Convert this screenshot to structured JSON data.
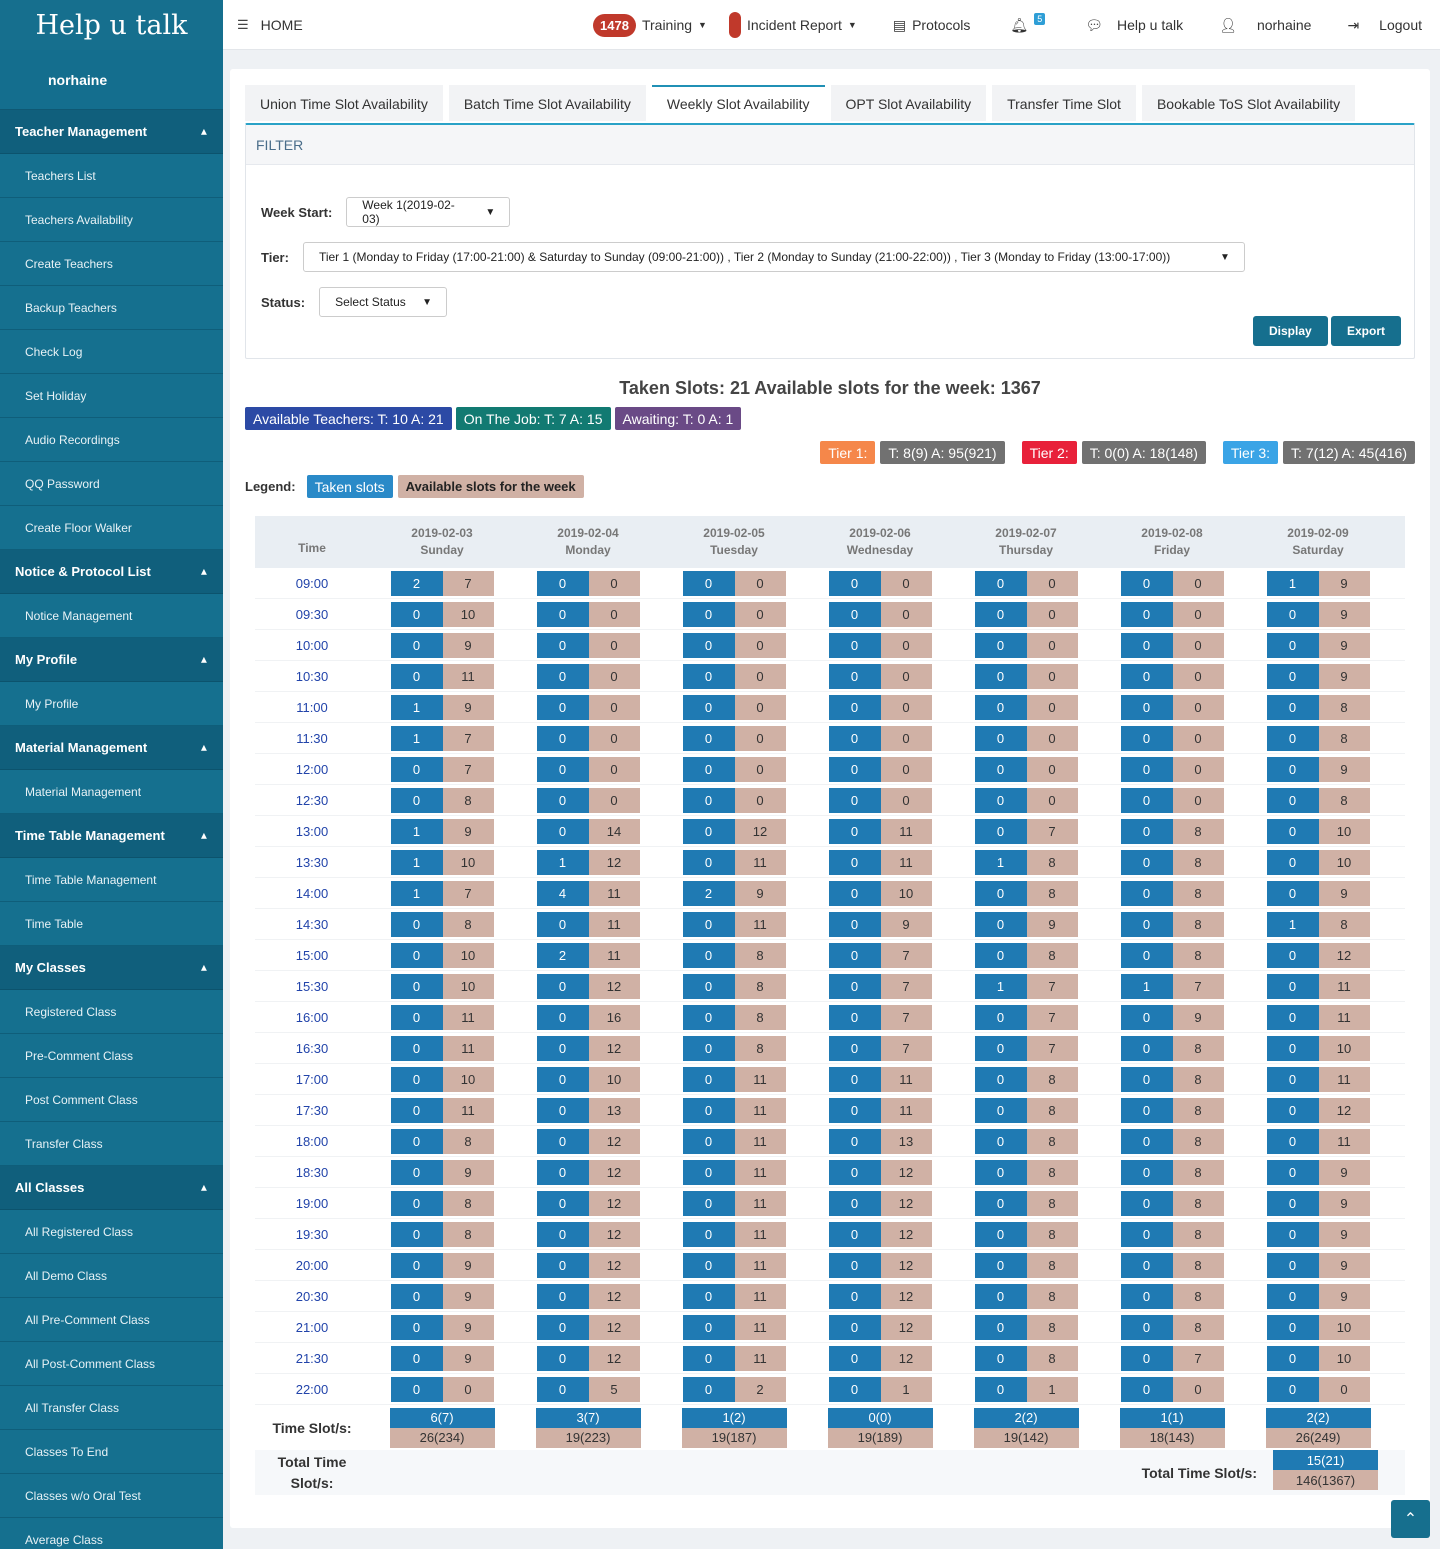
{
  "brand": "Help u talk",
  "sidebar": {
    "user": "norhaine",
    "sections": [
      {
        "title": "Teacher Management",
        "items": [
          "Teachers List",
          "Teachers Availability",
          "Create Teachers",
          "Backup Teachers",
          "Check Log",
          "Set Holiday",
          "Audio Recordings",
          "QQ Password",
          "Create Floor Walker"
        ]
      },
      {
        "title": "Notice & Protocol List",
        "items": [
          "Notice Management"
        ]
      },
      {
        "title": "My Profile",
        "items": [
          "My Profile"
        ]
      },
      {
        "title": "Material Management",
        "items": [
          "Material Management"
        ]
      },
      {
        "title": "Time Table Management",
        "items": [
          "Time Table Management",
          "Time Table"
        ]
      },
      {
        "title": "My Classes",
        "items": [
          "Registered Class",
          "Pre-Comment Class",
          "Post Comment Class",
          "Transfer Class"
        ]
      },
      {
        "title": "All Classes",
        "items": [
          "All Registered Class",
          "All Demo Class",
          "All Pre-Comment Class",
          "All Post-Comment Class",
          "All Transfer Class",
          "Classes To End",
          "Classes w/o Oral Test",
          "Average Class"
        ]
      }
    ]
  },
  "topbar": {
    "home": "HOME",
    "training_count": "1478",
    "training": "Training",
    "incident": "Incident Report",
    "protocols": "Protocols",
    "notif_count": "5",
    "help": "Help u talk",
    "user": "norhaine",
    "logout": "Logout"
  },
  "tabs": [
    "Union Time Slot Availability",
    "Batch Time Slot Availability",
    "Weekly Slot Availability",
    "OPT Slot Availability",
    "Transfer Time Slot",
    "Bookable ToS Slot Availability"
  ],
  "filter": {
    "title": "FILTER",
    "week_label": "Week Start:",
    "week_value": "Week 1(2019-02-03)",
    "tier_label": "Tier:",
    "tier_value": "Tier 1 (Monday to Friday (17:00-21:00) & Saturday to Sunday (09:00-21:00)) , Tier 2 (Monday to Sunday (21:00-22:00)) , Tier 3 (Monday to Friday (13:00-17:00))",
    "status_label": "Status:",
    "status_value": "Select Status",
    "display": "Display",
    "export": "Export"
  },
  "summary": "Taken Slots: 21  Available slots for the week: 1367",
  "pills": [
    {
      "text": "Available Teachers: T: 10 A: 21",
      "color": "#2c4aa5"
    },
    {
      "text": "On The Job: T: 7 A: 15",
      "color": "#127a72"
    },
    {
      "text": "Awaiting: T: 0 A: 1",
      "color": "#6a4a86"
    }
  ],
  "tiers": [
    {
      "label": "Tier 1:",
      "value": "T: 8(9) A: 95(921)",
      "color": "#f5874a"
    },
    {
      "label": "Tier 2:",
      "value": "T: 0(0) A: 18(148)",
      "color": "#e8213a"
    },
    {
      "label": "Tier 3:",
      "value": "T: 7(12) A: 45(416)",
      "color": "#3aa4e6"
    }
  ],
  "legend": {
    "label": "Legend:",
    "taken": "Taken slots",
    "available": "Available slots for the week"
  },
  "table": {
    "time_header": "Time",
    "days": [
      {
        "date": "2019-02-03",
        "day": "Sunday"
      },
      {
        "date": "2019-02-04",
        "day": "Monday"
      },
      {
        "date": "2019-02-05",
        "day": "Tuesday"
      },
      {
        "date": "2019-02-06",
        "day": "Wednesday"
      },
      {
        "date": "2019-02-07",
        "day": "Thursday"
      },
      {
        "date": "2019-02-08",
        "day": "Friday"
      },
      {
        "date": "2019-02-09",
        "day": "Saturday"
      }
    ],
    "rows": [
      {
        "time": "09:00",
        "cells": [
          [
            2,
            7
          ],
          [
            0,
            0
          ],
          [
            0,
            0
          ],
          [
            0,
            0
          ],
          [
            0,
            0
          ],
          [
            0,
            0
          ],
          [
            1,
            9
          ]
        ]
      },
      {
        "time": "09:30",
        "cells": [
          [
            0,
            10
          ],
          [
            0,
            0
          ],
          [
            0,
            0
          ],
          [
            0,
            0
          ],
          [
            0,
            0
          ],
          [
            0,
            0
          ],
          [
            0,
            9
          ]
        ]
      },
      {
        "time": "10:00",
        "cells": [
          [
            0,
            9
          ],
          [
            0,
            0
          ],
          [
            0,
            0
          ],
          [
            0,
            0
          ],
          [
            0,
            0
          ],
          [
            0,
            0
          ],
          [
            0,
            9
          ]
        ]
      },
      {
        "time": "10:30",
        "cells": [
          [
            0,
            11
          ],
          [
            0,
            0
          ],
          [
            0,
            0
          ],
          [
            0,
            0
          ],
          [
            0,
            0
          ],
          [
            0,
            0
          ],
          [
            0,
            9
          ]
        ]
      },
      {
        "time": "11:00",
        "cells": [
          [
            1,
            9
          ],
          [
            0,
            0
          ],
          [
            0,
            0
          ],
          [
            0,
            0
          ],
          [
            0,
            0
          ],
          [
            0,
            0
          ],
          [
            0,
            8
          ]
        ]
      },
      {
        "time": "11:30",
        "cells": [
          [
            1,
            7
          ],
          [
            0,
            0
          ],
          [
            0,
            0
          ],
          [
            0,
            0
          ],
          [
            0,
            0
          ],
          [
            0,
            0
          ],
          [
            0,
            8
          ]
        ]
      },
      {
        "time": "12:00",
        "cells": [
          [
            0,
            7
          ],
          [
            0,
            0
          ],
          [
            0,
            0
          ],
          [
            0,
            0
          ],
          [
            0,
            0
          ],
          [
            0,
            0
          ],
          [
            0,
            9
          ]
        ]
      },
      {
        "time": "12:30",
        "cells": [
          [
            0,
            8
          ],
          [
            0,
            0
          ],
          [
            0,
            0
          ],
          [
            0,
            0
          ],
          [
            0,
            0
          ],
          [
            0,
            0
          ],
          [
            0,
            8
          ]
        ]
      },
      {
        "time": "13:00",
        "cells": [
          [
            1,
            9
          ],
          [
            0,
            14
          ],
          [
            0,
            12
          ],
          [
            0,
            11
          ],
          [
            0,
            7
          ],
          [
            0,
            8
          ],
          [
            0,
            10
          ]
        ]
      },
      {
        "time": "13:30",
        "cells": [
          [
            1,
            10
          ],
          [
            1,
            12
          ],
          [
            0,
            11
          ],
          [
            0,
            11
          ],
          [
            1,
            8
          ],
          [
            0,
            8
          ],
          [
            0,
            10
          ]
        ]
      },
      {
        "time": "14:00",
        "cells": [
          [
            1,
            7
          ],
          [
            4,
            11
          ],
          [
            2,
            9
          ],
          [
            0,
            10
          ],
          [
            0,
            8
          ],
          [
            0,
            8
          ],
          [
            0,
            9
          ]
        ]
      },
      {
        "time": "14:30",
        "cells": [
          [
            0,
            8
          ],
          [
            0,
            11
          ],
          [
            0,
            11
          ],
          [
            0,
            9
          ],
          [
            0,
            9
          ],
          [
            0,
            8
          ],
          [
            1,
            8
          ]
        ]
      },
      {
        "time": "15:00",
        "cells": [
          [
            0,
            10
          ],
          [
            2,
            11
          ],
          [
            0,
            8
          ],
          [
            0,
            7
          ],
          [
            0,
            8
          ],
          [
            0,
            8
          ],
          [
            0,
            12
          ]
        ]
      },
      {
        "time": "15:30",
        "cells": [
          [
            0,
            10
          ],
          [
            0,
            12
          ],
          [
            0,
            8
          ],
          [
            0,
            7
          ],
          [
            1,
            7
          ],
          [
            1,
            7
          ],
          [
            0,
            11
          ]
        ]
      },
      {
        "time": "16:00",
        "cells": [
          [
            0,
            11
          ],
          [
            0,
            16
          ],
          [
            0,
            8
          ],
          [
            0,
            7
          ],
          [
            0,
            7
          ],
          [
            0,
            9
          ],
          [
            0,
            11
          ]
        ]
      },
      {
        "time": "16:30",
        "cells": [
          [
            0,
            11
          ],
          [
            0,
            12
          ],
          [
            0,
            8
          ],
          [
            0,
            7
          ],
          [
            0,
            7
          ],
          [
            0,
            8
          ],
          [
            0,
            10
          ]
        ]
      },
      {
        "time": "17:00",
        "cells": [
          [
            0,
            10
          ],
          [
            0,
            10
          ],
          [
            0,
            11
          ],
          [
            0,
            11
          ],
          [
            0,
            8
          ],
          [
            0,
            8
          ],
          [
            0,
            11
          ]
        ]
      },
      {
        "time": "17:30",
        "cells": [
          [
            0,
            11
          ],
          [
            0,
            13
          ],
          [
            0,
            11
          ],
          [
            0,
            11
          ],
          [
            0,
            8
          ],
          [
            0,
            8
          ],
          [
            0,
            12
          ]
        ]
      },
      {
        "time": "18:00",
        "cells": [
          [
            0,
            8
          ],
          [
            0,
            12
          ],
          [
            0,
            11
          ],
          [
            0,
            13
          ],
          [
            0,
            8
          ],
          [
            0,
            8
          ],
          [
            0,
            11
          ]
        ]
      },
      {
        "time": "18:30",
        "cells": [
          [
            0,
            9
          ],
          [
            0,
            12
          ],
          [
            0,
            11
          ],
          [
            0,
            12
          ],
          [
            0,
            8
          ],
          [
            0,
            8
          ],
          [
            0,
            9
          ]
        ]
      },
      {
        "time": "19:00",
        "cells": [
          [
            0,
            8
          ],
          [
            0,
            12
          ],
          [
            0,
            11
          ],
          [
            0,
            12
          ],
          [
            0,
            8
          ],
          [
            0,
            8
          ],
          [
            0,
            9
          ]
        ]
      },
      {
        "time": "19:30",
        "cells": [
          [
            0,
            8
          ],
          [
            0,
            12
          ],
          [
            0,
            11
          ],
          [
            0,
            12
          ],
          [
            0,
            8
          ],
          [
            0,
            8
          ],
          [
            0,
            9
          ]
        ]
      },
      {
        "time": "20:00",
        "cells": [
          [
            0,
            9
          ],
          [
            0,
            12
          ],
          [
            0,
            11
          ],
          [
            0,
            12
          ],
          [
            0,
            8
          ],
          [
            0,
            8
          ],
          [
            0,
            9
          ]
        ]
      },
      {
        "time": "20:30",
        "cells": [
          [
            0,
            9
          ],
          [
            0,
            12
          ],
          [
            0,
            11
          ],
          [
            0,
            12
          ],
          [
            0,
            8
          ],
          [
            0,
            8
          ],
          [
            0,
            9
          ]
        ]
      },
      {
        "time": "21:00",
        "cells": [
          [
            0,
            9
          ],
          [
            0,
            12
          ],
          [
            0,
            11
          ],
          [
            0,
            12
          ],
          [
            0,
            8
          ],
          [
            0,
            8
          ],
          [
            0,
            10
          ]
        ]
      },
      {
        "time": "21:30",
        "cells": [
          [
            0,
            9
          ],
          [
            0,
            12
          ],
          [
            0,
            11
          ],
          [
            0,
            12
          ],
          [
            0,
            8
          ],
          [
            0,
            7
          ],
          [
            0,
            10
          ]
        ]
      },
      {
        "time": "22:00",
        "cells": [
          [
            0,
            0
          ],
          [
            0,
            5
          ],
          [
            0,
            2
          ],
          [
            0,
            1
          ],
          [
            0,
            1
          ],
          [
            0,
            0
          ],
          [
            0,
            0
          ]
        ]
      }
    ],
    "totals_label": "Time Slot/s:",
    "totals": [
      {
        "t": "6(7)",
        "a": "26(234)"
      },
      {
        "t": "3(7)",
        "a": "19(223)"
      },
      {
        "t": "1(2)",
        "a": "19(187)"
      },
      {
        "t": "0(0)",
        "a": "19(189)"
      },
      {
        "t": "2(2)",
        "a": "19(142)"
      },
      {
        "t": "1(1)",
        "a": "18(143)"
      },
      {
        "t": "2(2)",
        "a": "26(249)"
      }
    ],
    "grand_label_left": "Total Time Slot/s:",
    "grand_label_right": "Total Time Slot/s:",
    "grand_t": "15(21)",
    "grand_a": "146(1367)"
  }
}
